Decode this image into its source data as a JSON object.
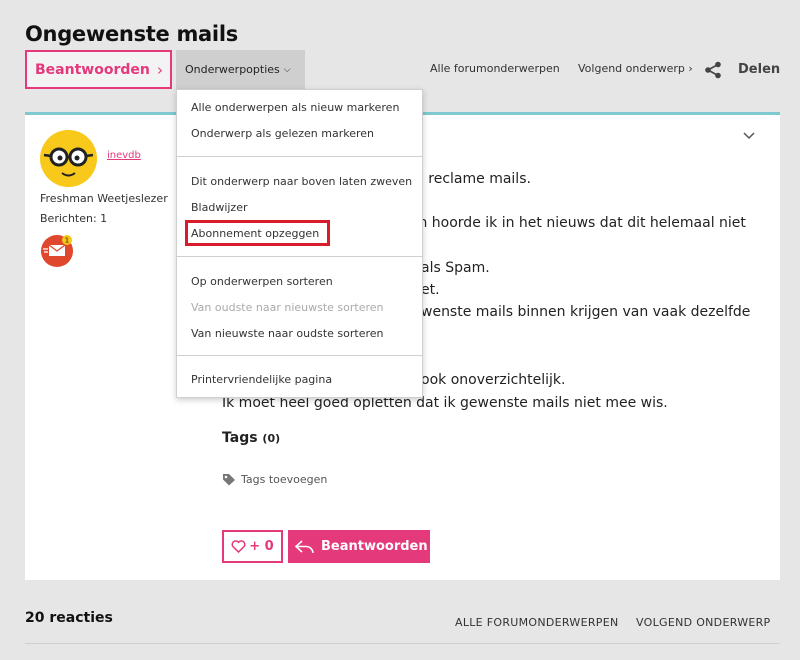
{
  "page": {
    "title": "Ongewenste mails"
  },
  "toolbar": {
    "reply_label": "Beantwoorden",
    "topic_options_label": "Onderwerpopties",
    "all_topics_label": "Alle forumonderwerpen",
    "next_topic_label": "Volgend onderwerp",
    "share_label": "Delen"
  },
  "menu": {
    "items": [
      {
        "label": "Alle onderwerpen als nieuw markeren",
        "enabled": true
      },
      {
        "label": "Onderwerp als gelezen markeren",
        "enabled": true
      },
      {
        "label": "Dit onderwerp naar boven laten zweven",
        "enabled": true
      },
      {
        "label": "Bladwijzer",
        "enabled": true
      },
      {
        "label": "Abonnement opzeggen",
        "enabled": true,
        "highlighted": true
      },
      {
        "label": "Op onderwerpen sorteren",
        "enabled": true
      },
      {
        "label": "Van oudste naar nieuwste sorteren",
        "enabled": false
      },
      {
        "label": "Van nieuwste naar oudste sorteren",
        "enabled": true
      },
      {
        "label": "Printervriendelijke pagina",
        "enabled": true
      }
    ]
  },
  "author": {
    "username": "inevdb",
    "rank": "Freshman Weetjeslezer",
    "posts": "Berichten: 1",
    "badge_count": "1"
  },
  "post": {
    "lines": [
      "00 reclame mails.",
      "lan hoorde ik in het nieuws dat dit helemaal niet",
      "als Spam.",
      "et.",
      "wenste mails binnen krijgen van vaak dezelfde",
      "ook onoverzichtelijk.",
      "Ik moet heel goed opletten dat ik gewenste mails niet mee wis."
    ]
  },
  "tags": {
    "title": "Tags",
    "count": "(0)",
    "add_label": "Tags toevoegen"
  },
  "actions": {
    "like_label": "+ 0",
    "reply_label": "Beantwoorden"
  },
  "footer": {
    "reactions": "20 reacties",
    "all_topics": "ALLE FORUMONDERWERPEN",
    "next_topic": "VOLGEND ONDERWERP"
  },
  "colors": {
    "accent": "#e4397b",
    "card_top_border": "#7ec9cf",
    "highlight": "#d71c2c",
    "background": "#e6e6e6"
  }
}
